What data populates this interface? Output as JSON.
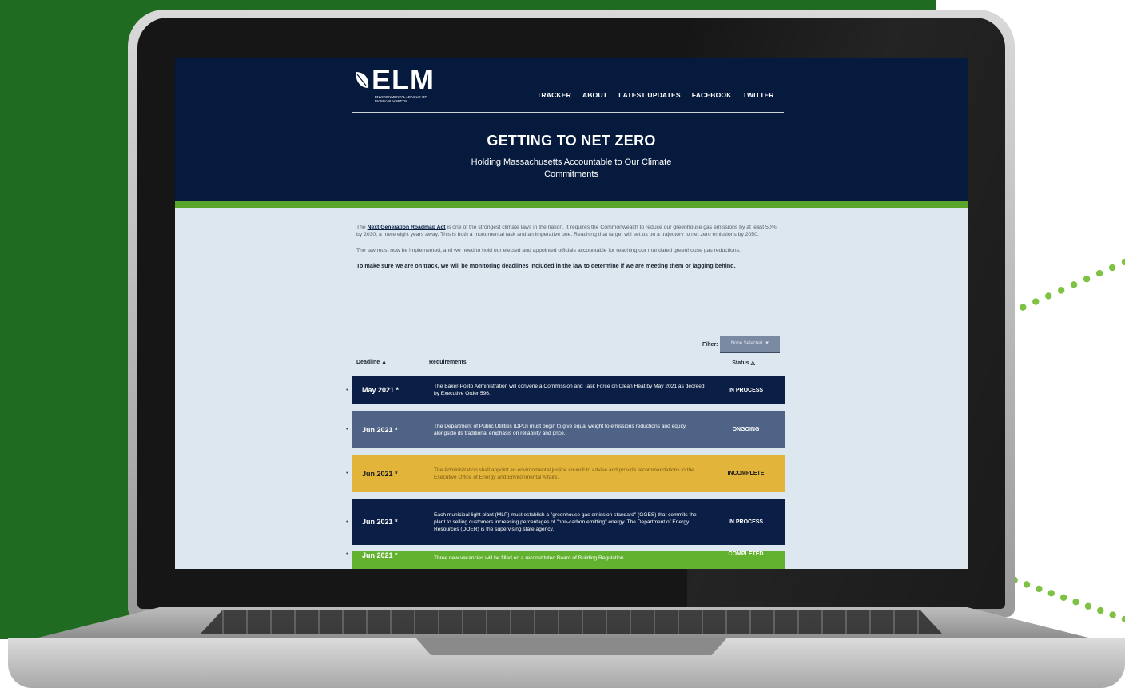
{
  "site": {
    "logo_word": "ELM",
    "logo_subtitle": "Environmental League of Massachusetts",
    "nav": [
      "TRACKER",
      "ABOUT",
      "LATEST UPDATES",
      "FACEBOOK",
      "TWITTER"
    ],
    "hero_title": "GETTING TO NET ZERO",
    "hero_subtitle": "Holding Massachusetts Accountable to Our Climate Commitments"
  },
  "intro": {
    "p1_prefix": "The ",
    "p1_link": "Next Generation Roadmap Act",
    "p1_rest": " is one of the strongest climate laws in the nation. It requires the Commonwealth to reduce our greenhouse gas emissions by at least 50% by 2030, a mere eight years away. This is both a monumental task and an imperative one. Reaching that target will set us on a trajectory to net zero emissions by 2050.",
    "p2": "The law must now be implemented, and we need to hold our elected and appointed officials accountable for reaching our mandated greenhouse gas reductions.",
    "p3": "To make sure we are on track, we will be monitoring deadlines included in the law to determine if we are meeting them or lagging behind."
  },
  "filter": {
    "label": "Filter:",
    "selected": "None Selected",
    "arrow": "▼"
  },
  "table": {
    "headers": {
      "deadline": "Deadline ▲",
      "requirements": "Requirements",
      "status": "Status △"
    },
    "rows": [
      {
        "deadline": "May 2021 *",
        "requirement": "The Baker-Polito Administration will convene a Commission and Task Force on Clean Heat by May 2021 as decreed by Executive Order 596.",
        "status": "IN PROCESS",
        "color": "#0b1e45"
      },
      {
        "deadline": "Jun 2021 *",
        "requirement": "The Department of Public Utilities (DPU) must begin to give equal weight to emissions reductions and equity alongside its traditional emphasis on reliability and price.",
        "status": "ONGOING",
        "color": "#4f6386"
      },
      {
        "deadline": "Jun 2021 *",
        "requirement": "The Administration shall appoint an environmental justice council to advise and provide recommendations to the Executive Office of Energy and Environmental Affairs.",
        "status": "INCOMPLETE",
        "color": "#e3b43a"
      },
      {
        "deadline": "Jun 2021 *",
        "requirement": "Each municipal light plant (MLP) must establish a \"greenhouse gas emission standard\" (GGES) that commits the plant to selling customers increasing percentages of \"non-carbon emitting\" energy. The Department of Energy Resources (DOER) is the supervising state agency.",
        "status": "IN PROCESS",
        "color": "#0b1e45"
      },
      {
        "deadline": "Jun 2021 *",
        "requirement": "Three new vacancies will be filled on a reconstituted Board of Building Regulation",
        "status": "COMPLETED",
        "color": "#62b22f"
      }
    ]
  },
  "colors": {
    "brand_navy": "#061a3d",
    "brand_green": "#5aa62c",
    "background_green": "#1f6b22",
    "dots_green": "#7dc242"
  }
}
